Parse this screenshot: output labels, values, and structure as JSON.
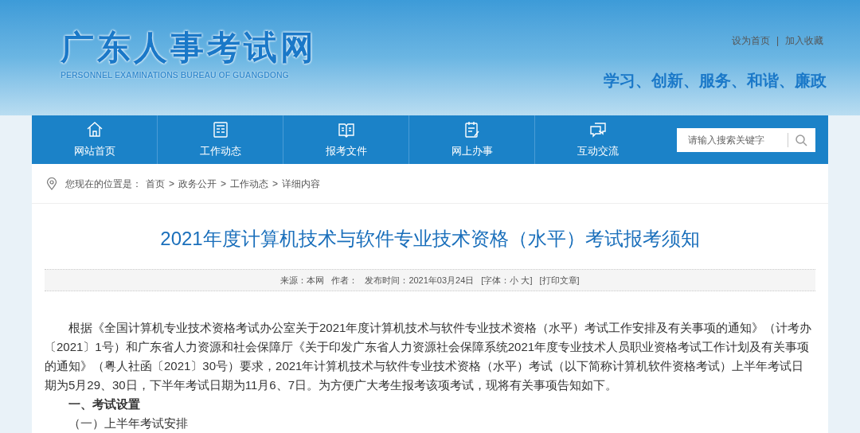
{
  "header": {
    "logo_title": "广东人事考试网",
    "logo_subtitle": "PERSONNEL EXAMINATIONS BUREAU OF GUANGDONG",
    "top_links": [
      "设为首页",
      "加入收藏"
    ],
    "top_links_separator": "|",
    "slogan": "学习、创新、服务、和谐、廉政"
  },
  "nav": {
    "items": [
      {
        "label": "网站首页"
      },
      {
        "label": "工作动态"
      },
      {
        "label": "报考文件"
      },
      {
        "label": "网上办事"
      },
      {
        "label": "互动交流"
      }
    ],
    "search": {
      "placeholder": "请输入搜索关键字"
    }
  },
  "breadcrumb": {
    "label": "您现在的位置是：",
    "items": [
      "首页",
      "政务公开",
      "工作动态",
      "详细内容"
    ],
    "separators": [
      ">",
      ">",
      ">"
    ]
  },
  "article": {
    "title": "2021年度计算机技术与软件专业技术资格（水平）考试报考须知",
    "meta": [
      "来源：本网",
      "作者：",
      "发布时间：2021年03月24日",
      "[字体：小 大]",
      "[打印文章]"
    ],
    "paragraphs": [
      {
        "kind": "body",
        "text": "根据《全国计算机专业技术资格考试办公室关于2021年度计算机技术与软件专业技术资格（水平）考试工作安排及有关事项的通知》（计考办〔2021〕1号）和广东省人力资源和社会保障厅《关于印发广东省人力资源社会保障系统2021年度专业技术人员职业资格考试工作计划及有关事项的通知》（粤人社函〔2021〕30号）要求，2021年计算机技术与软件专业技术资格（水平）考试（以下简称计算机软件资格考试）上半年考试日期为5月29、30日，下半年考试日期为11月6、7日。为方便广大考生报考该项考试，现将有关事项告知如下。"
      },
      {
        "kind": "heading",
        "text": "一、考试设置"
      },
      {
        "kind": "subheading",
        "text": "（一）上半年考试安排"
      }
    ]
  }
}
